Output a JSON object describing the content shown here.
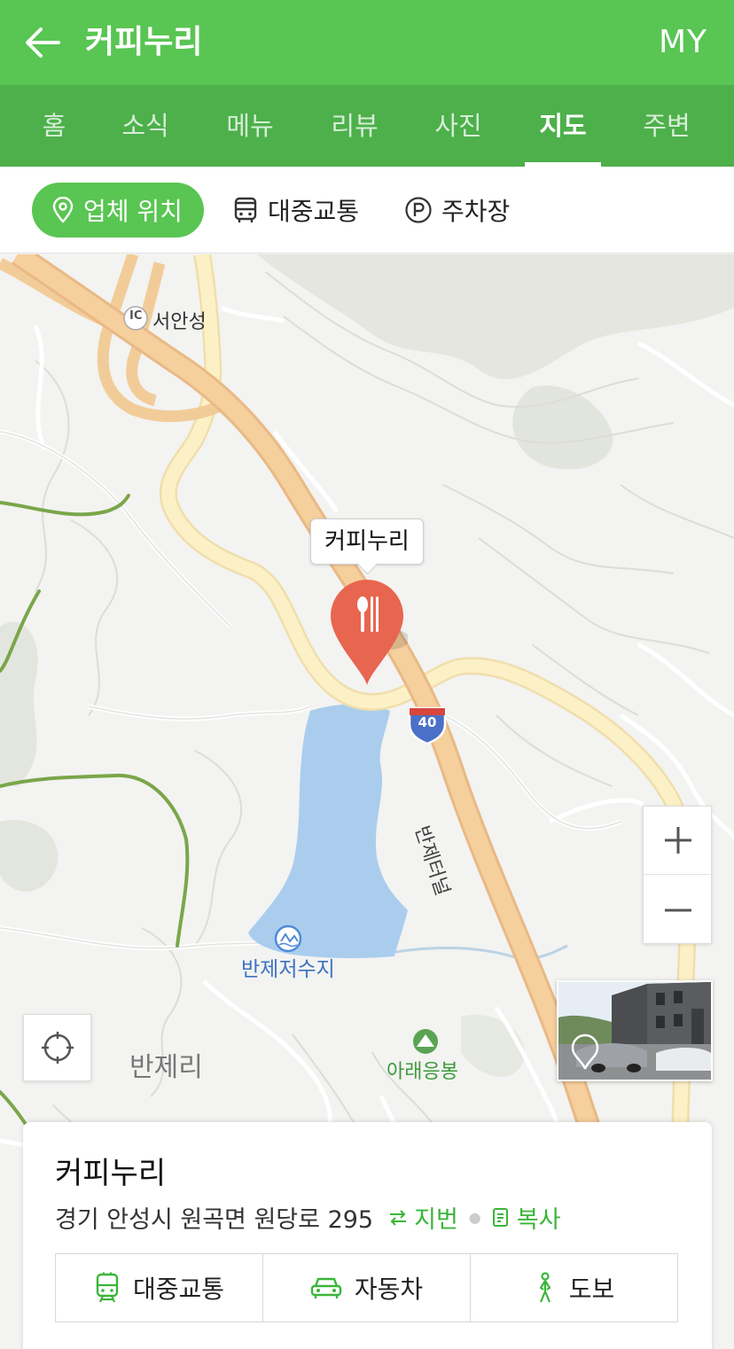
{
  "header": {
    "title": "커피누리",
    "my_label": "MY"
  },
  "tabs": [
    {
      "label": "홈"
    },
    {
      "label": "소식"
    },
    {
      "label": "메뉴"
    },
    {
      "label": "리뷰"
    },
    {
      "label": "사진"
    },
    {
      "label": "지도",
      "active": true
    },
    {
      "label": "주변"
    }
  ],
  "subtabs": {
    "location": "업체 위치",
    "transit": "대중교통",
    "parking": "주차장"
  },
  "map": {
    "marker_label": "커피누리",
    "ic_badge": "IC",
    "labels": {
      "interchange": "서안성",
      "highway_number": "40",
      "tunnel": "반제터널",
      "reservoir": "반제저수지",
      "village": "반제리",
      "peak": "아래응봉"
    }
  },
  "card": {
    "title": "커피누리",
    "address": "경기 안성시 원곡면 원당로 295",
    "lot_number_label": "지번",
    "copy_label": "복사",
    "routes": {
      "transit": "대중교통",
      "car": "자동차",
      "walk": "도보"
    }
  },
  "colors": {
    "header_green": "#59c553",
    "tab_green": "#4db04b",
    "pin_red": "#e8654f",
    "link_green": "#3bb53a"
  }
}
